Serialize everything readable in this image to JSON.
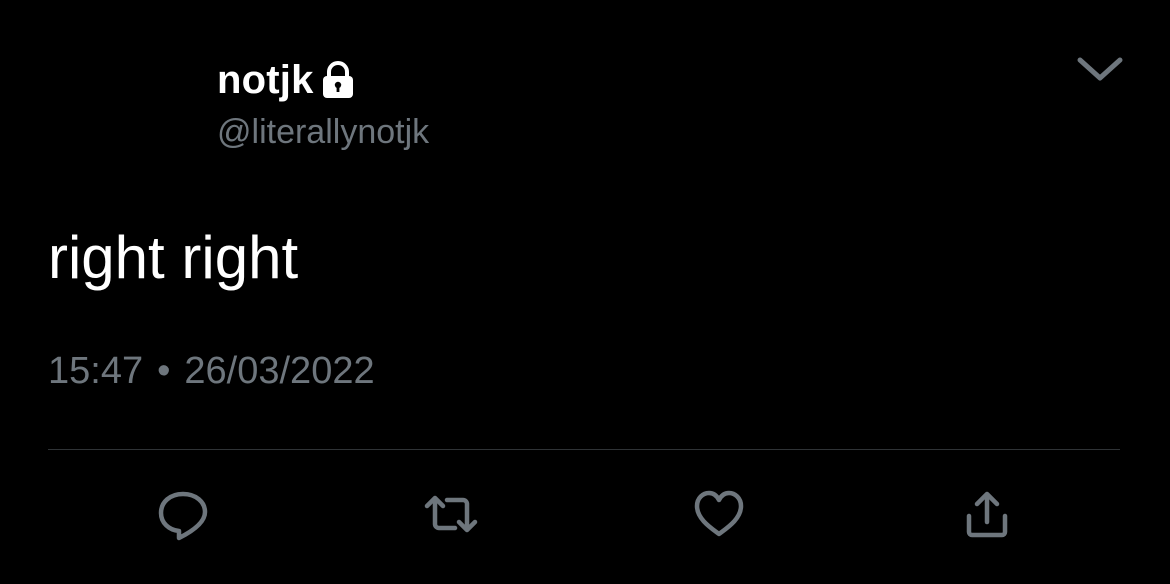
{
  "tweet": {
    "display_name": "notjk",
    "handle": "@literallynotjk",
    "text": "right right",
    "time": "15:47",
    "separator": "•",
    "date": "26/03/2022"
  },
  "icons": {
    "lock": "lock-icon",
    "more": "chevron-down-icon",
    "reply": "reply-icon",
    "retweet": "retweet-icon",
    "like": "heart-icon",
    "share": "share-icon"
  },
  "colors": {
    "background": "#000000",
    "primary_text": "#ffffff",
    "secondary_text": "#6e767d",
    "divider": "#2f3336",
    "icon": "#6e767d"
  }
}
